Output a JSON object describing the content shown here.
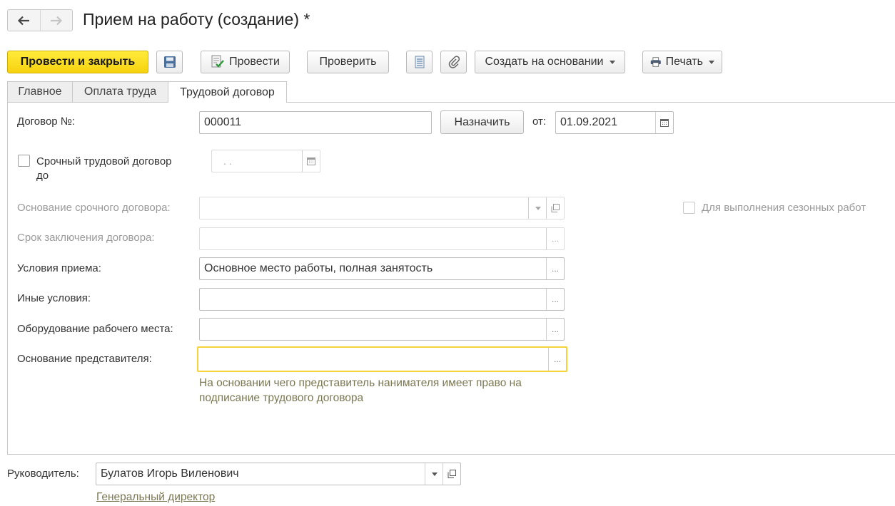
{
  "window": {
    "title": "Прием на работу (создание) *"
  },
  "toolbar": {
    "post_close": "Провести и закрыть",
    "post": "Провести",
    "check": "Проверить",
    "create_based": "Создать на основании",
    "print": "Печать"
  },
  "tabs": [
    {
      "label": "Главное"
    },
    {
      "label": "Оплата труда"
    },
    {
      "label": "Трудовой договор",
      "active": true
    }
  ],
  "form": {
    "contract_no_label": "Договор №:",
    "contract_no_value": "000011",
    "assign_button": "Назначить",
    "from_label": "от:",
    "from_date": "01.09.2021",
    "fixed_term_label_1": "Срочный трудовой договор",
    "fixed_term_label_2": "до",
    "fixed_term_checked": false,
    "fixed_term_date": " .  .",
    "fixed_term_basis_label": "Основание срочного договора:",
    "seasonal_label": "Для выполнения сезонных работ",
    "conclusion_period_label": "Срок заключения договора:",
    "conditions_label": "Условия приема:",
    "conditions_value": "Основное место работы, полная занятость",
    "other_conditions_label": "Иные условия:",
    "equipment_label": "Оборудование рабочего места:",
    "rep_basis_label": "Основание представителя:",
    "rep_basis_hint_1": "На основании чего представитель нанимателя имеет право на",
    "rep_basis_hint_2": "подписание трудового договора"
  },
  "footer": {
    "manager_label": "Руководитель:",
    "manager_value": "Булатов Игорь Виленович",
    "position_link": "Генеральный директор"
  },
  "icons": {
    "dots": "...",
    "back": "arrow-left-icon",
    "forward": "arrow-right-icon"
  }
}
